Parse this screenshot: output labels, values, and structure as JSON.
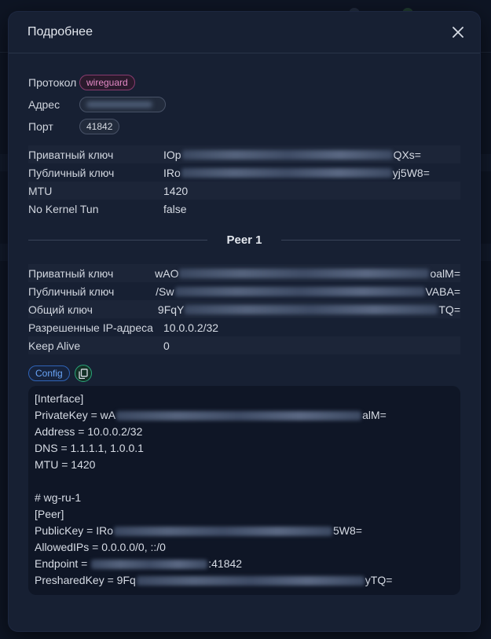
{
  "modal": {
    "title": "Подробнее",
    "close_icon": "close-icon"
  },
  "info": {
    "protocol_label": "Протокол",
    "protocol_value": "wireguard",
    "address_label": "Адрес",
    "address_value": "",
    "port_label": "Порт",
    "port_value": "41842"
  },
  "interface": [
    {
      "key": "Приватный ключ",
      "prefix": "IOp",
      "suffix": "QXs="
    },
    {
      "key": "Публичный ключ",
      "prefix": "IRo",
      "suffix": "yj5W8="
    },
    {
      "key": "MTU",
      "prefix": "1420",
      "suffix": ""
    },
    {
      "key": "No Kernel Tun",
      "prefix": "false",
      "suffix": ""
    }
  ],
  "peer_title": "Peer 1",
  "peer": [
    {
      "key": "Приватный ключ",
      "prefix": "wAO",
      "suffix": "oalM="
    },
    {
      "key": "Публичный ключ",
      "prefix": "/Sw",
      "suffix": "VABA="
    },
    {
      "key": "Общий ключ",
      "prefix": "9FqY",
      "suffix": "TQ="
    },
    {
      "key": "Разрешенные IP-адреса",
      "prefix": "10.0.0.2/32",
      "suffix": ""
    },
    {
      "key": "Keep Alive",
      "prefix": "0",
      "suffix": ""
    }
  ],
  "config": {
    "tag_label": "Config",
    "copy_icon": "copy-icon",
    "lines": [
      {
        "prefix": "[Interface]",
        "suffix": ""
      },
      {
        "prefix": "PrivateKey = wA",
        "suffix": "alM="
      },
      {
        "prefix": "Address = 10.0.0.2/32",
        "suffix": ""
      },
      {
        "prefix": "DNS = 1.1.1.1, 1.0.0.1",
        "suffix": ""
      },
      {
        "prefix": "MTU = 1420",
        "suffix": ""
      },
      {
        "prefix": "",
        "suffix": ""
      },
      {
        "prefix": "# wg-ru-1",
        "suffix": ""
      },
      {
        "prefix": "[Peer]",
        "suffix": ""
      },
      {
        "prefix": "PublicKey = IRo",
        "suffix": "5W8="
      },
      {
        "prefix": "AllowedIPs = 0.0.0.0/0, ::/0",
        "suffix": ""
      },
      {
        "prefix": "Endpoint = ",
        "suffix": ":41842"
      },
      {
        "prefix": "PresharedKey = 9Fq",
        "suffix": "yTQ="
      }
    ]
  },
  "colors": {
    "protocol_tag": "#e48ac6",
    "config_tag": "#6aa4f5",
    "copy_button": "#2aa57a"
  }
}
